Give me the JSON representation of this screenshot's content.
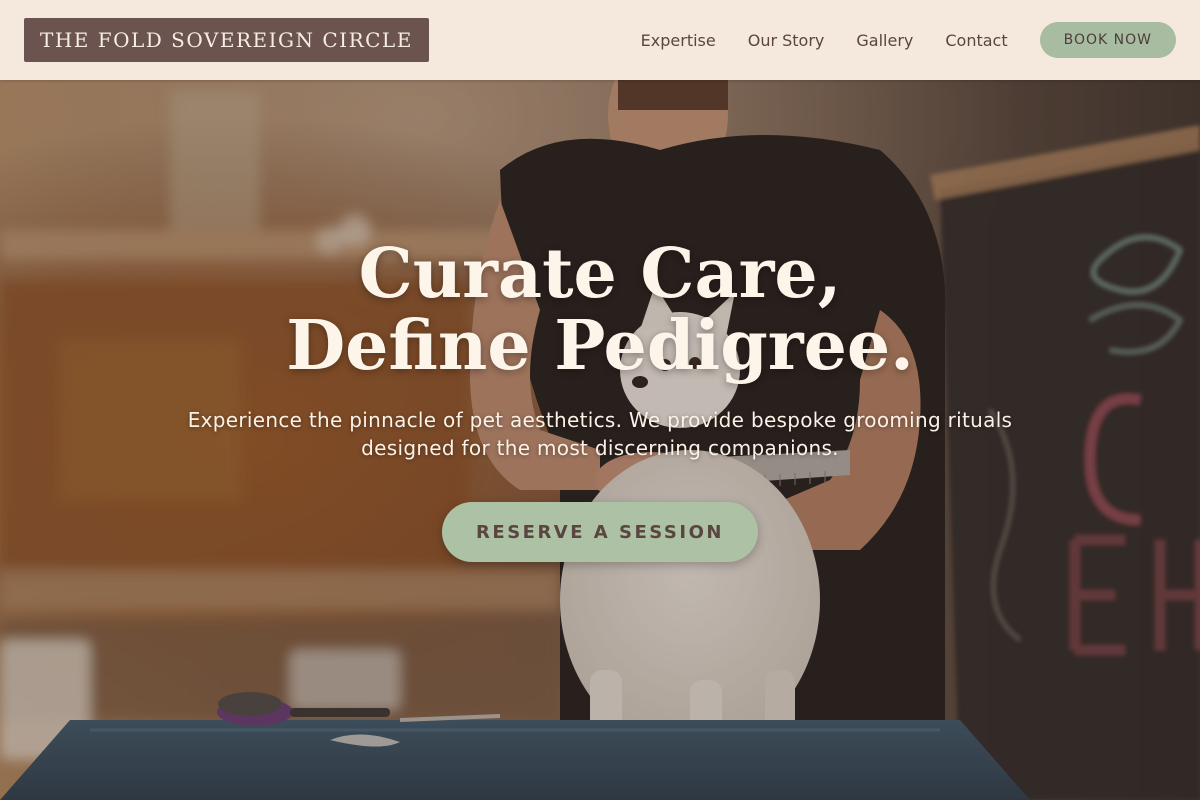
{
  "header": {
    "logo_text": "THE FOLD SOVEREIGN CIRCLE",
    "nav": [
      {
        "label": "Expertise"
      },
      {
        "label": "Our Story"
      },
      {
        "label": "Gallery"
      },
      {
        "label": "Contact"
      }
    ],
    "book_button": "BOOK NOW"
  },
  "hero": {
    "headline_line1": "Curate Care,",
    "headline_line2": "Define Pedigree.",
    "subtext_line1": "Experience the pinnacle of pet aesthetics. We provide bespoke grooming rituals",
    "subtext_line2": "designed for the most discerning companions.",
    "cta": "RESERVE A SESSION"
  },
  "colors": {
    "header_bg": "#f4e9dc",
    "logo_bg": "#6b5350",
    "accent_sage": "#a7bca0",
    "text_brown": "#5a4541",
    "headline_cream": "#fdf5ea"
  }
}
